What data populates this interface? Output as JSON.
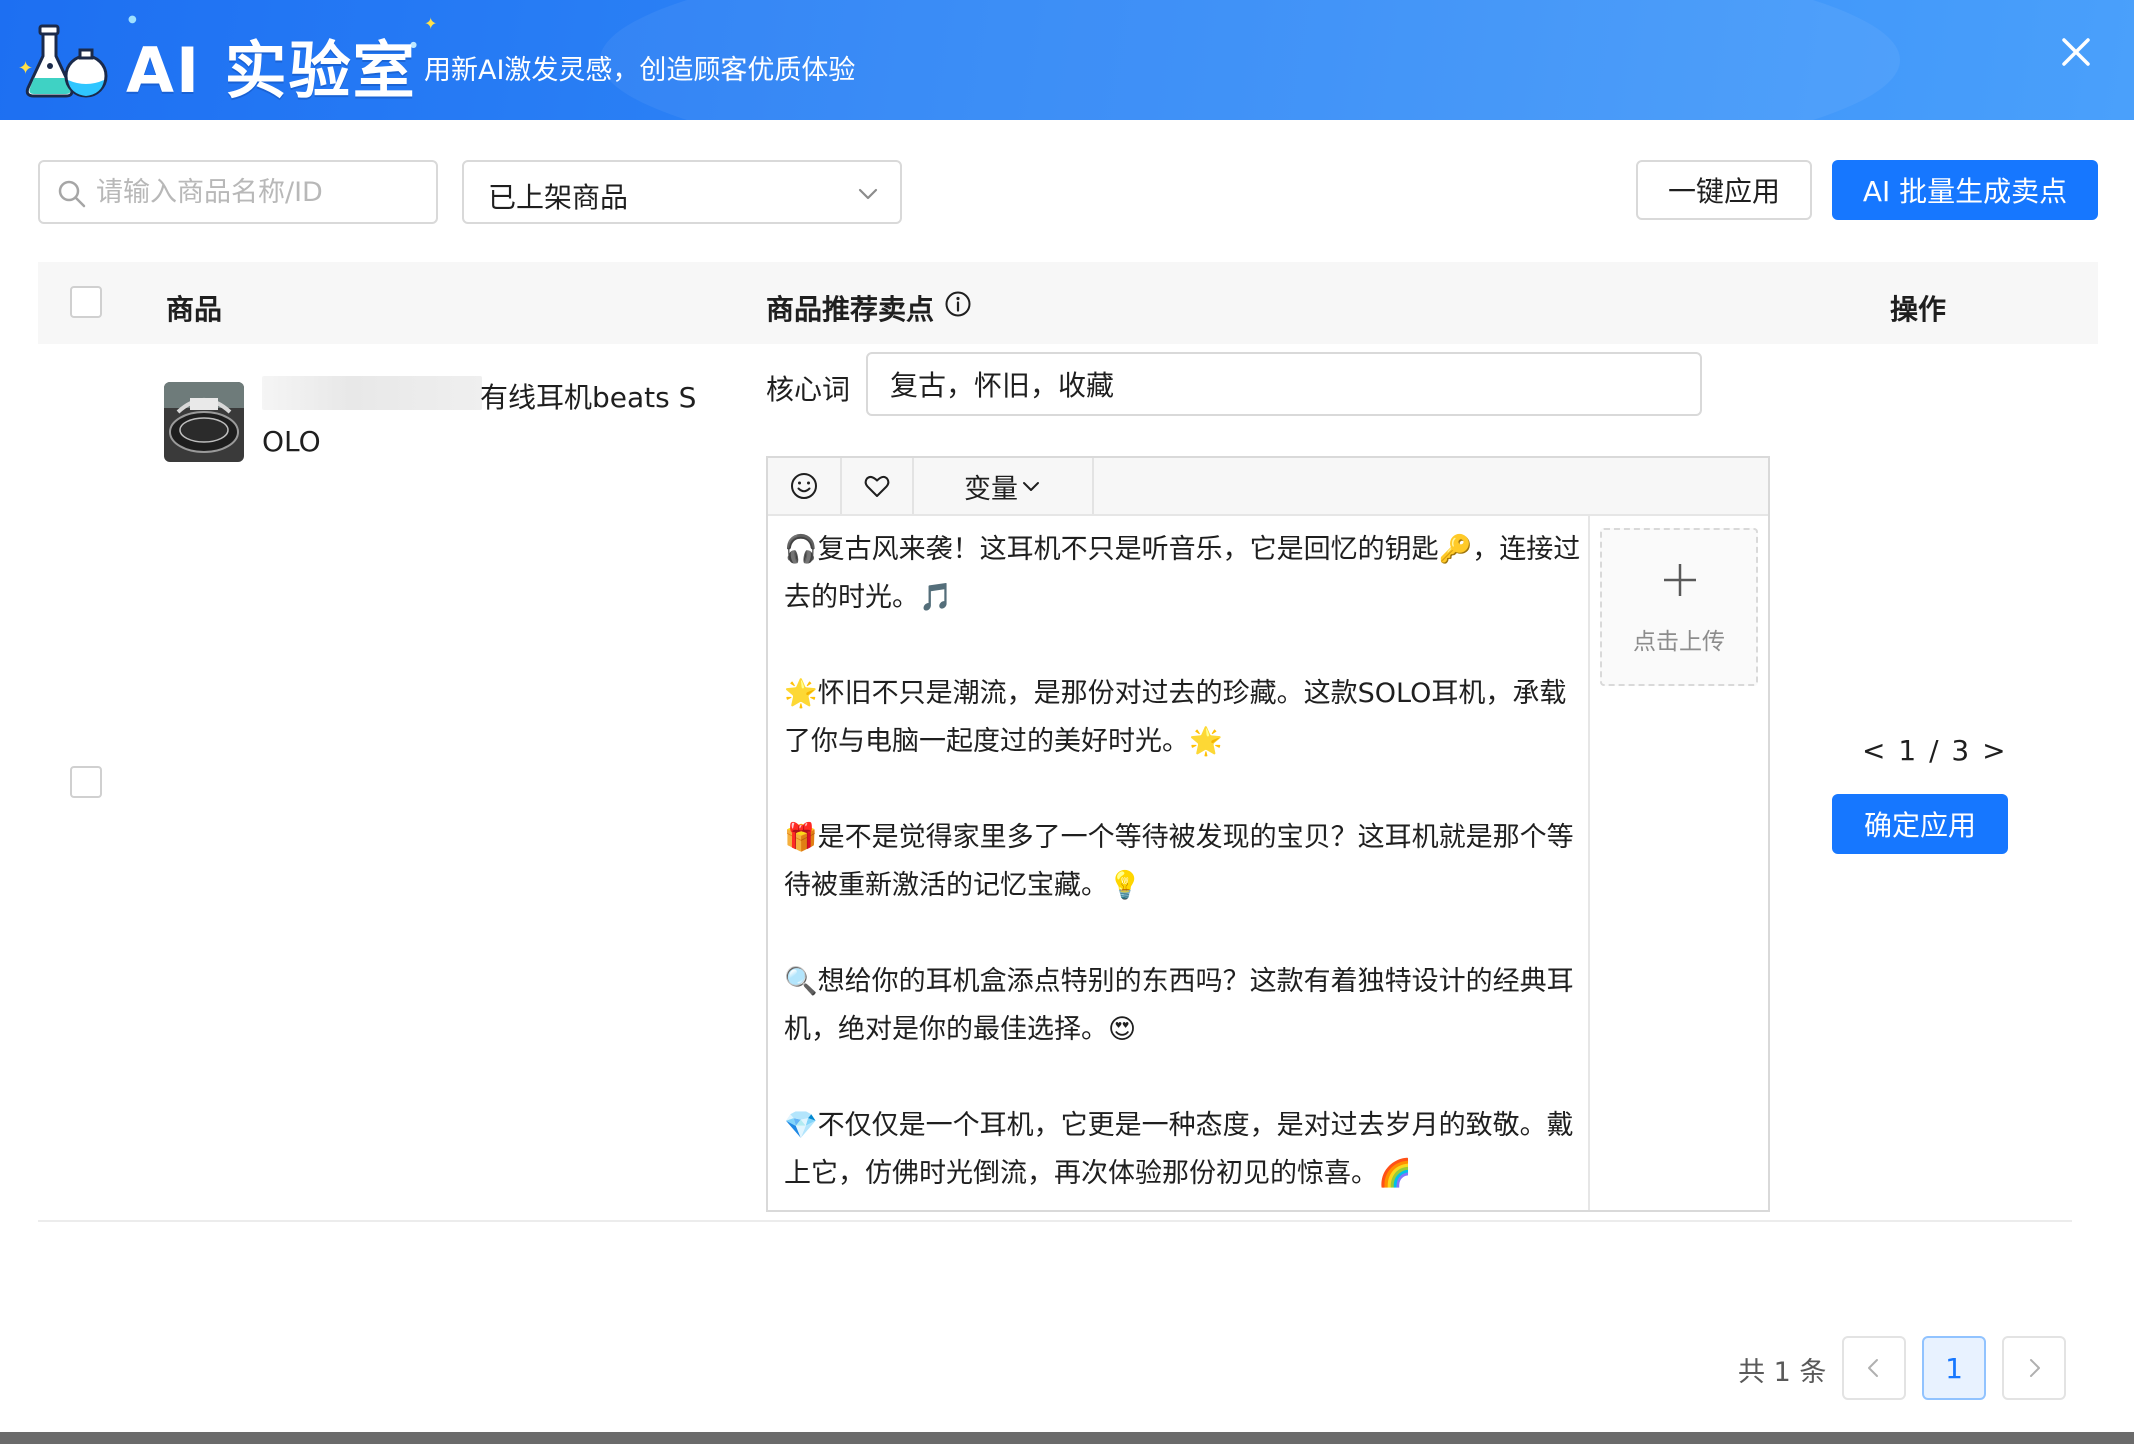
{
  "header": {
    "title": "AI 实验室",
    "subtitle": "用新AI激发灵感，创造顾客优质体验",
    "icon": "flask-icon",
    "close_icon": "close-icon"
  },
  "toolbar": {
    "search_placeholder": "请输入商品名称/ID",
    "search_value": "",
    "filter_selected": "已上架商品",
    "apply_all_label": "一键应用",
    "batch_generate_label": "AI 批量生成卖点"
  },
  "table": {
    "columns": {
      "product": "商品",
      "selling_points": "商品推荐卖点",
      "actions": "操作"
    },
    "rows": [
      {
        "product_name_line1": "有线耳机beats S",
        "product_name_line2": "OLO",
        "keyword_label": "核心词",
        "keyword_value": "复古，怀旧，收藏",
        "editor": {
          "toolbar": {
            "emoji_icon": "smile-icon",
            "heart_icon": "heart-icon",
            "variable_label": "变量"
          },
          "paragraphs": [
            "🎧复古风来袭！这耳机不只是听音乐，它是回忆的钥匙🔑，连接过去的时光。🎵",
            "🌟怀旧不只是潮流，是那份对过去的珍藏。这款SOLO耳机，承载了你与电脑一起度过的美好时光。🌟",
            "🎁是不是觉得家里多了一个等待被发现的宝贝？这耳机就是那个等待被重新激活的记忆宝藏。💡",
            "🔍想给你的耳机盒添点特别的东西吗？这款有着独特设计的经典耳机，绝对是你的最佳选择。😍",
            "💎不仅仅是一个耳机，它更是一种态度，是对过去岁月的致敬。戴上它，仿佛时光倒流，再次体验那份初见的惊喜。🌈"
          ],
          "upload_label": "点击上传"
        },
        "version_pager": "< 1 / 3 >",
        "confirm_label": "确定应用"
      }
    ]
  },
  "pagination": {
    "total_label": "共 1 条",
    "current_page": "1"
  },
  "colors": {
    "primary": "#1677ff",
    "header_gradient_start": "#1d6ff2",
    "header_gradient_end": "#4aa0fb"
  }
}
